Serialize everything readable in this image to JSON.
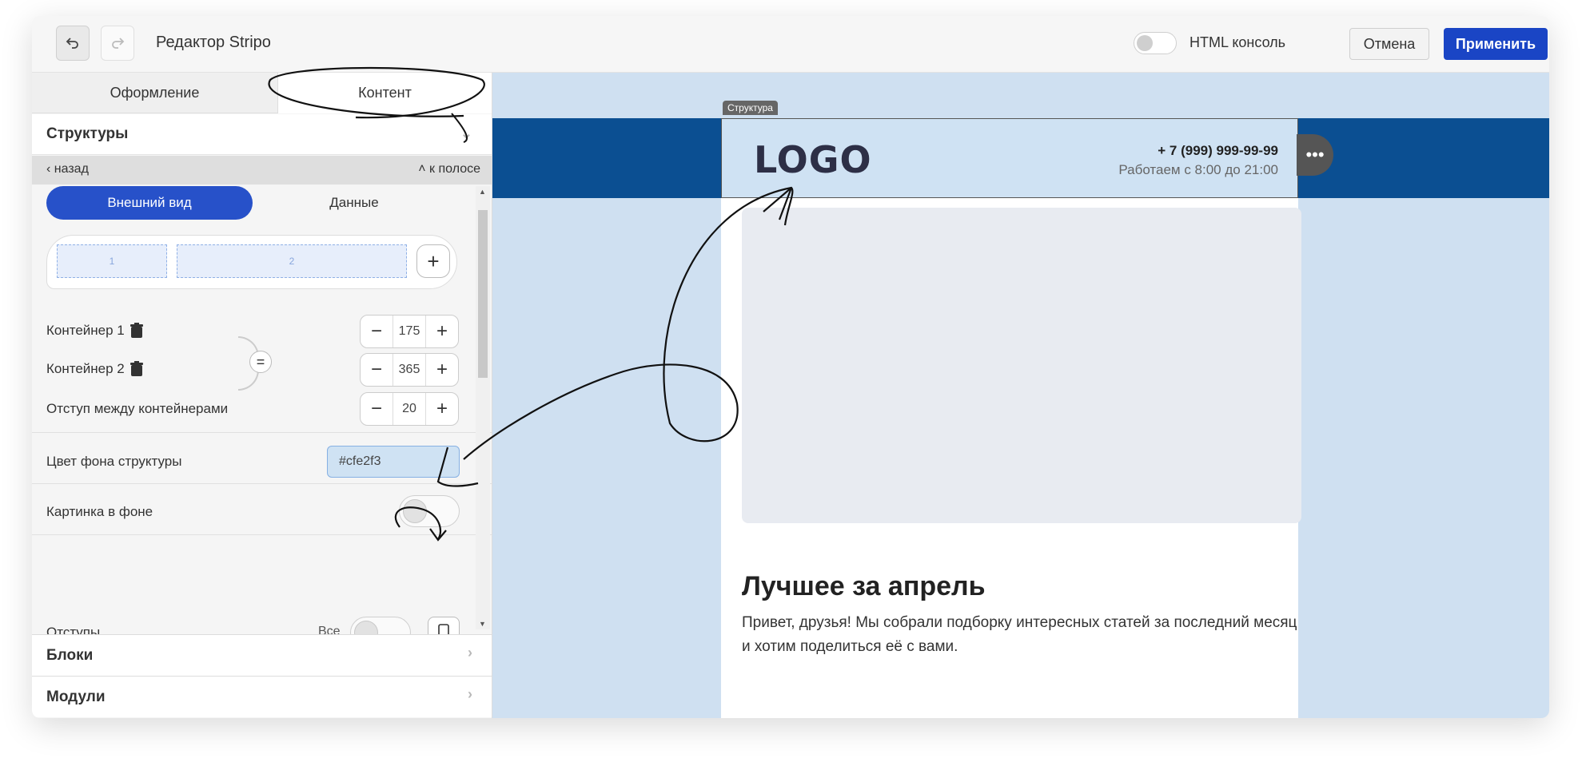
{
  "toolbar": {
    "undo_icon": "undo-icon",
    "redo_icon": "redo-icon",
    "title": "Редактор Stripo",
    "html_console_label": "HTML консоль",
    "html_console_on": false,
    "cancel_label": "Отмена",
    "apply_label": "Применить"
  },
  "left_panel": {
    "tabs": [
      {
        "label": "Оформление",
        "active": false
      },
      {
        "label": "Контент",
        "active": true
      }
    ],
    "section_title": "Структуры",
    "subnav": {
      "back_label": "назад",
      "to_stripe_label": "к полосе"
    },
    "segment": {
      "active_label": "Внешний вид",
      "inactive_label": "Данные"
    },
    "columns": [
      {
        "label": "1"
      },
      {
        "label": "2"
      }
    ],
    "containers": [
      {
        "label": "Контейнер 1",
        "value": "175"
      },
      {
        "label": "Контейнер 2",
        "value": "365"
      }
    ],
    "gap": {
      "label": "Отступ между контейнерами",
      "value": "20"
    },
    "bg_color": {
      "label": "Цвет фона структуры",
      "value": "#cfe2f3"
    },
    "bg_image": {
      "label": "Картинка в фоне",
      "on": false
    },
    "paddings": {
      "label": "Отступы",
      "all_label": "Все"
    },
    "accordion": [
      {
        "label": "Блоки"
      },
      {
        "label": "Модули"
      }
    ]
  },
  "canvas": {
    "structure_tag": "Структура",
    "logo_text": "LOGO",
    "phone": "+ 7 (999) 999-99-99",
    "hours": "Работаем с 8:00 до 21:00",
    "heading": "Лучшее за апрель",
    "paragraph": "Привет, друзья! Мы собрали подборку интересных статей за последний месяц и хотим поделиться её с вами.",
    "more_icon": "more-dots-icon"
  },
  "colors": {
    "accent": "#2751c9",
    "apply": "#1a45c5",
    "band": "#0b4f92",
    "canvas_bg": "#cfe0f1",
    "structure_bg": "#cfe2f3"
  }
}
